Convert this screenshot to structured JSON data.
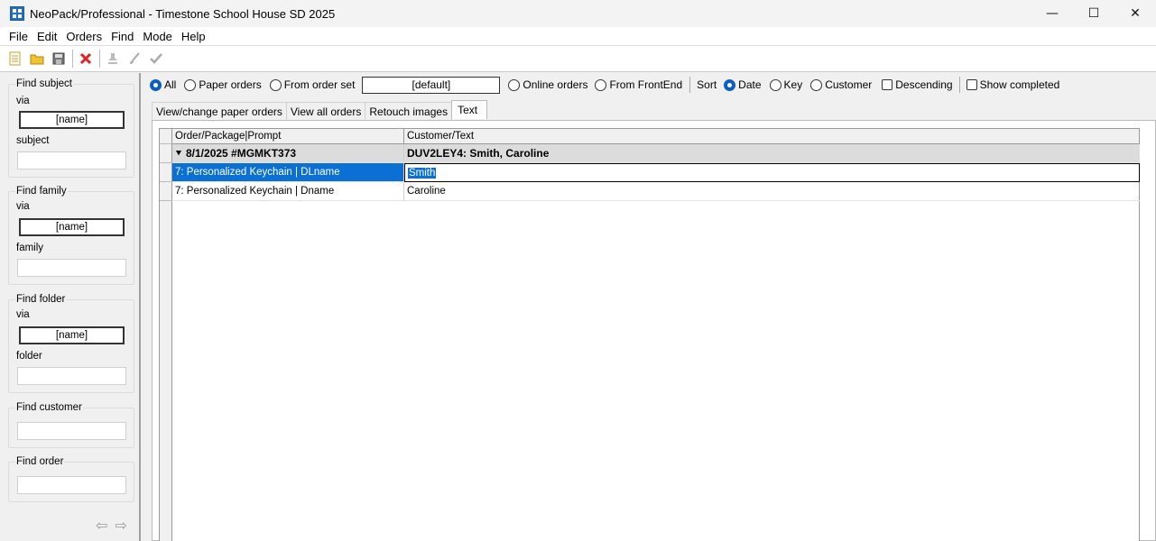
{
  "window": {
    "title": "NeoPack/Professional - Timestone School House SD 2025",
    "controls": {
      "minimize": "—",
      "maximize": "☐",
      "close": "✕"
    }
  },
  "menu": [
    "File",
    "Edit",
    "Orders",
    "Find",
    "Mode",
    "Help"
  ],
  "toolbar": {
    "icons": [
      "new-icon",
      "open-icon",
      "save-icon",
      "delete-icon",
      "stamp-icon",
      "brush-icon",
      "checkmark-icon"
    ]
  },
  "left_panel": {
    "find_subject": {
      "title": "Find subject",
      "via": "via",
      "via_value": "[name]",
      "field_label": "subject",
      "field_value": ""
    },
    "find_family": {
      "title": "Find family",
      "via": "via",
      "via_value": "[name]",
      "field_label": "family",
      "field_value": ""
    },
    "find_folder": {
      "title": "Find folder",
      "via": "via",
      "via_value": "[name]",
      "field_label": "folder",
      "field_value": ""
    },
    "find_customer": {
      "title": "Find customer",
      "field_value": ""
    },
    "find_order": {
      "title": "Find order",
      "field_value": ""
    }
  },
  "filters": {
    "all": "All",
    "paper_orders": "Paper orders",
    "from_order_set": "From order set",
    "order_set_value": "[default]",
    "online_orders": "Online orders",
    "from_frontend": "From FrontEnd",
    "sort_label": "Sort",
    "sort_date": "Date",
    "sort_key": "Key",
    "sort_customer": "Customer",
    "descending": "Descending",
    "show_completed": "Show completed"
  },
  "tabs": [
    "View/change paper orders",
    "View all orders",
    "Retouch images",
    "Text"
  ],
  "grid": {
    "columns": [
      "Order/Package|Prompt",
      "Customer/Text"
    ],
    "group": {
      "order": "8/1/2025 #MGMKT373",
      "customer": "DUV2LEY4: Smith, Caroline"
    },
    "rows": [
      {
        "prompt": "7: Personalized Keychain | DLname",
        "text": "Smith"
      },
      {
        "prompt": "7: Personalized Keychain | Dname",
        "text": "Caroline"
      }
    ]
  }
}
